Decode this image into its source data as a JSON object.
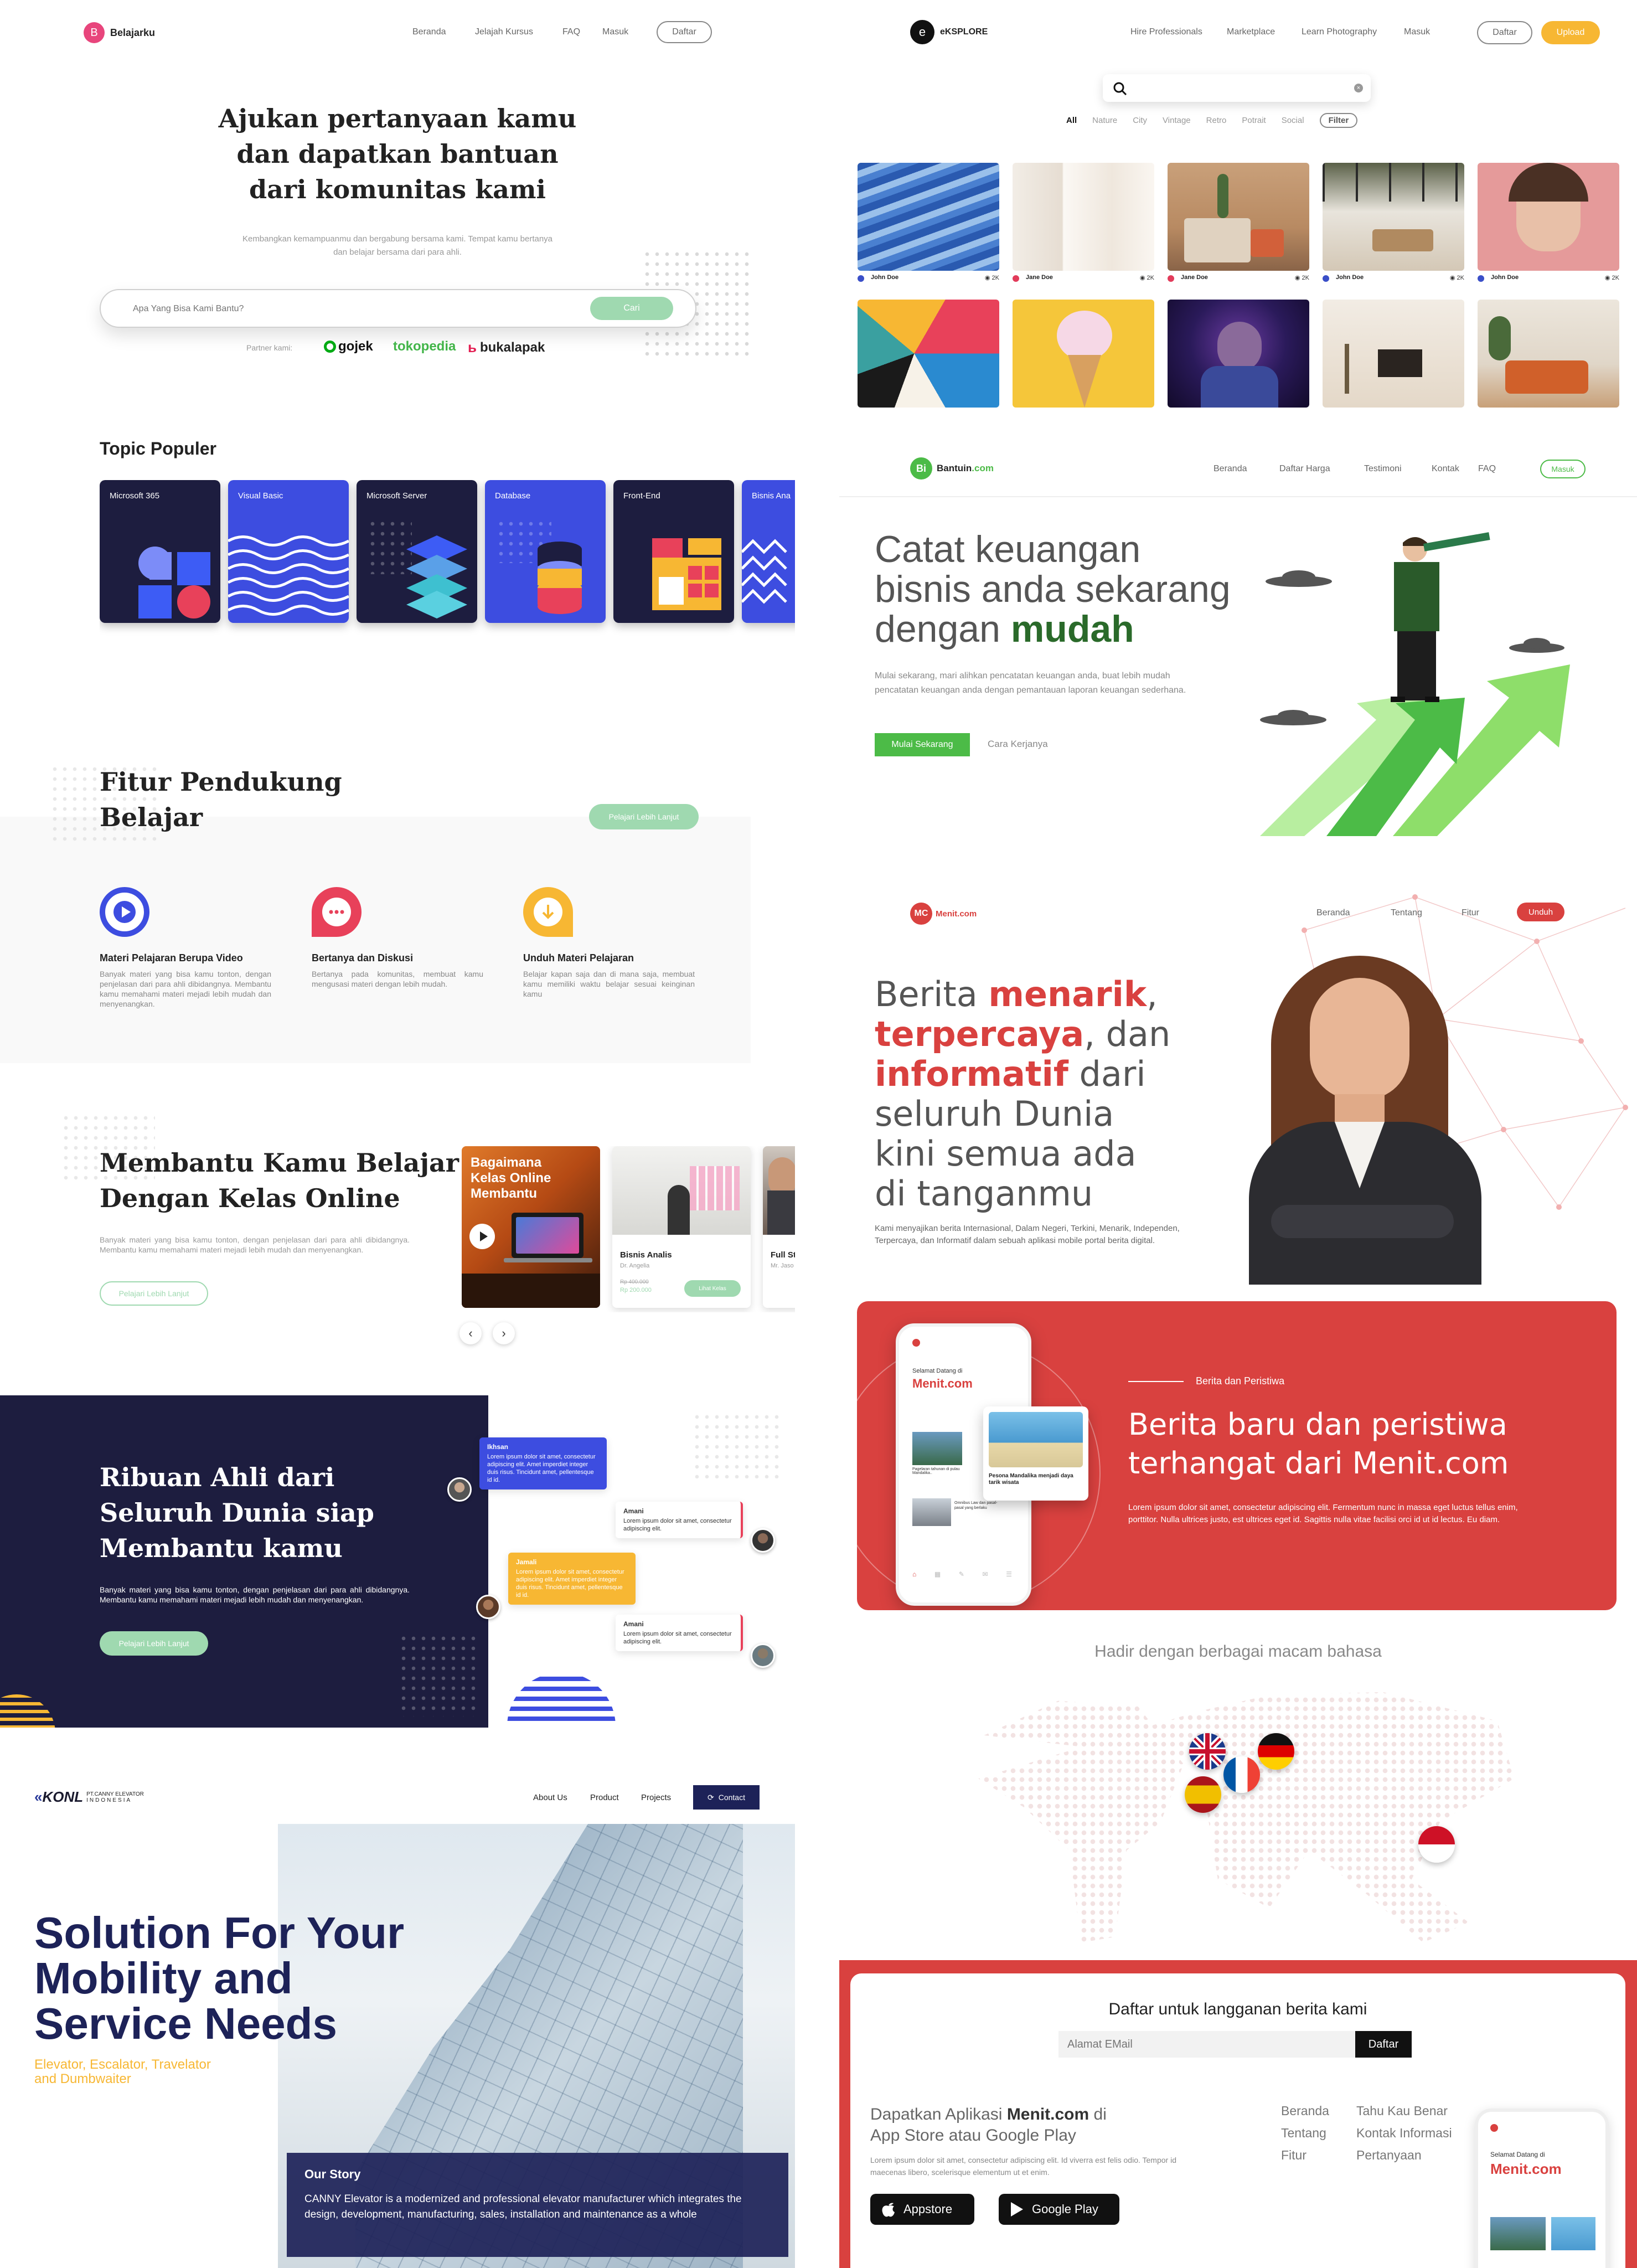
{
  "belajarku": {
    "logo_letter": "B",
    "brand": "Belajarku",
    "nav": [
      "Beranda",
      "Jelajah Kursus",
      "FAQ",
      "Masuk"
    ],
    "nav_cta": "Daftar",
    "hero_title": [
      "Ajukan pertanyaan kamu",
      "dan dapatkan bantuan",
      "dari komunitas kami"
    ],
    "hero_sub": [
      "Kembangkan kemampuanmu dan bergabung bersama kami. Tempat kamu bertanya",
      "dan belajar bersama dari para ahli."
    ],
    "search_placeholder": "Apa Yang Bisa Kami Bantu?",
    "search_button": "Cari",
    "partner_label": "Partner kami:",
    "partners": [
      "gojek",
      "tokopedia",
      "bukalapak"
    ],
    "topic_heading": "Topic Populer",
    "topics": [
      "Microsoft 365",
      "Visual Basic",
      "Microsoft Server",
      "Database",
      "Front-End",
      "Bisnis Ana"
    ],
    "fitur_heading": [
      "Fitur Pendukung",
      "Belajar"
    ],
    "fitur_button": "Pelajari Lebih Lanjut",
    "features": [
      {
        "title": "Materi Pelajaran Berupa Video",
        "desc": "Banyak materi yang bisa kamu tonton, dengan penjelasan dari para ahli dibidangnya. Membantu kamu memahami materi mejadi lebih mudah dan menyenangkan."
      },
      {
        "title": "Bertanya dan Diskusi",
        "desc": "Bertanya pada komunitas, membuat kamu mengusasi materi dengan lebih mudah."
      },
      {
        "title": "Unduh Materi Pelajaran",
        "desc": "Belajar kapan saja dan di mana saja, membuat kamu memiliki waktu belajar sesuai keinginan kamu"
      }
    ],
    "kelas_heading": [
      "Membantu Kamu Belajar",
      "Dengan Kelas Online"
    ],
    "kelas_desc": "Banyak materi yang bisa kamu tonton, dengan penjelasan dari para ahli dibidangnya. Membantu kamu memahami materi mejadi lebih mudah dan menyenangkan.",
    "kelas_button": "Pelajari Lebih Lanjut",
    "course_banner": [
      "Bagaimana",
      "Kelas Online",
      "Membantu"
    ],
    "course1": {
      "title": "Bisnis Analis",
      "author": "Dr. Angelia",
      "old_price": "Rp 400.000",
      "price": "Rp 200.000",
      "button": "Lihat Kelas"
    },
    "course2": {
      "title": "Full St",
      "author": "Mr. Jaso"
    },
    "ahli_heading": [
      "Ribuan Ahli dari",
      "Seluruh Dunia siap",
      "Membantu kamu"
    ],
    "ahli_desc": "Banyak materi yang bisa kamu tonton, dengan penjelasan dari para ahli dibidangnya. Membantu kamu memahami materi mejadi lebih mudah dan menyenangkan.",
    "ahli_button": "Pelajari Lebih Lanjut",
    "chats": [
      {
        "name": "Ikhsan",
        "text": "Lorem ipsum dolor sit amet, consectetur adipiscing elit. Amet imperdiet integer duis risus. Tincidunt amet, pellentesque id id."
      },
      {
        "name": "Amani",
        "text": "Lorem ipsum dolor sit amet, consectetur adipiscing elit."
      },
      {
        "name": "Jamali",
        "text": "Lorem ipsum dolor sit amet, consectetur adipiscing elit. Amet imperdiet integer duis risus. Tincidunt amet, pellentesque id id."
      },
      {
        "name": "Amani",
        "text": "Lorem ipsum dolor sit amet, consectetur adipiscing elit."
      }
    ]
  },
  "eksplore": {
    "logo_letter": "e",
    "brand": "eKSPLORE",
    "nav": [
      "Hire Professionals",
      "Marketplace",
      "Learn Photography",
      "Masuk"
    ],
    "btn_daftar": "Daftar",
    "btn_upload": "Upload",
    "filters": [
      "All",
      "Nature",
      "City",
      "Vintage",
      "Retro",
      "Potrait",
      "Social"
    ],
    "filter_button": "Filter",
    "photo_users": [
      "John Doe",
      "Jane Doe",
      "Jane Doe",
      "John Doe",
      "John Doe"
    ],
    "photo_views": "2K",
    "user_colors": [
      "#3a4fc8",
      "#e23b5a",
      "#e23b5a",
      "#3a4fc8",
      "#3a4fc8"
    ]
  },
  "bantuin": {
    "logo_text": "Bantuin",
    "logo_suffix": ".com",
    "nav": [
      "Beranda",
      "Daftar Harga",
      "Testimoni",
      "Kontak",
      "FAQ"
    ],
    "nav_cta": "Masuk",
    "title_lines": [
      "Catat keuangan",
      "bisnis anda sekarang",
      "dengan "
    ],
    "title_accent": "mudah",
    "sub": [
      "Mulai sekarang, mari alihkan pencatatan keuangan anda, buat lebih mudah",
      "pencatatan keuangan anda dengan pemantauan laporan keuangan sederhana."
    ],
    "primary": "Mulai Sekarang",
    "secondary": "Cara Kerjanya"
  },
  "menit": {
    "logo_badge": "MC",
    "brand": "Menit.com",
    "nav": [
      "Beranda",
      "Tentang",
      "Fitur"
    ],
    "nav_cta": "Unduh",
    "hero_parts": [
      [
        "Berita ",
        "menarik",
        ","
      ],
      [
        "",
        "terpercaya",
        ", dan"
      ],
      [
        "",
        "informatif",
        " dari"
      ],
      [
        "seluruh Dunia",
        "",
        ""
      ],
      [
        "kini semua ada",
        "",
        ""
      ],
      [
        "di tanganmu",
        "",
        ""
      ]
    ],
    "hero_desc": "Kami menyajikan berita Internasional, Dalam Negeri, Terkini, Menarik, Independen, Terpercaya, dan Informatif dalam sebuah aplikasi mobile portal berita digital.",
    "red_kicker": "Berita dan Peristiwa",
    "red_title": [
      "Berita baru dan peristiwa",
      "terhangat dari Menit.com"
    ],
    "red_desc": "Lorem ipsum dolor sit amet, consectetur adipiscing elit. Fermentum nunc in massa eget luctus tellus enim, porttitor. Nulla ultrices justo, est ultrices eget id. Sagittis nulla vitae facilisi orci id ut id lectus. Eu diam.",
    "phone_welcome": "Selamat Datang di",
    "phone_brand": "Menit.com",
    "phone_card": "Pesona Mandalika menjadi daya tarik wisata",
    "phone_item1": "Pagelaran tahunan di pulau Mandalika..",
    "phone_item2": "Omnibus Law dan pasal-pasal yang berlaku",
    "bahasa_title": "Hadir dengan berbagai macam bahasa",
    "sub_title": "Daftar untuk langganan berita kami",
    "sub_placeholder": "Alamat EMail",
    "sub_button": "Daftar",
    "app_title_1": "Dapatkan Aplikasi ",
    "app_title_brand": "Menit.com",
    "app_title_2": " di",
    "app_title_3": "App Store atau Google Play",
    "app_desc": "Lorem ipsum dolor sit amet, consectetur adipiscing elit. Id viverra est felis odio. Tempor id maecenas libero, scelerisque elementum ut et enim.",
    "appstore": "Appstore",
    "googleplay": "Google Play",
    "footer_col1": [
      "Beranda",
      "Tentang",
      "Fitur"
    ],
    "footer_col2": [
      "Tahu Kau Benar",
      "Kontak Informasi",
      "Pertanyaan"
    ],
    "accent": "#d9413f"
  },
  "canny": {
    "logo": "KONL",
    "logo_sub": [
      "PT.CANNY ELEVATOR",
      "INDONESIA"
    ],
    "nav": [
      "About Us",
      "Product",
      "Projects"
    ],
    "nav_cta": "Contact",
    "hero": [
      "Solution For Your",
      "Mobility and",
      "Service Needs"
    ],
    "hero_sub": [
      "Elevator, Escalator, Travelator",
      "and Dumbwaiter"
    ],
    "story_title": "Our Story",
    "story_text": "CANNY Elevator is a modernized and professional elevator manufacturer which integrates the design, development, manufacturing, sales, installation and maintenance as a whole"
  }
}
